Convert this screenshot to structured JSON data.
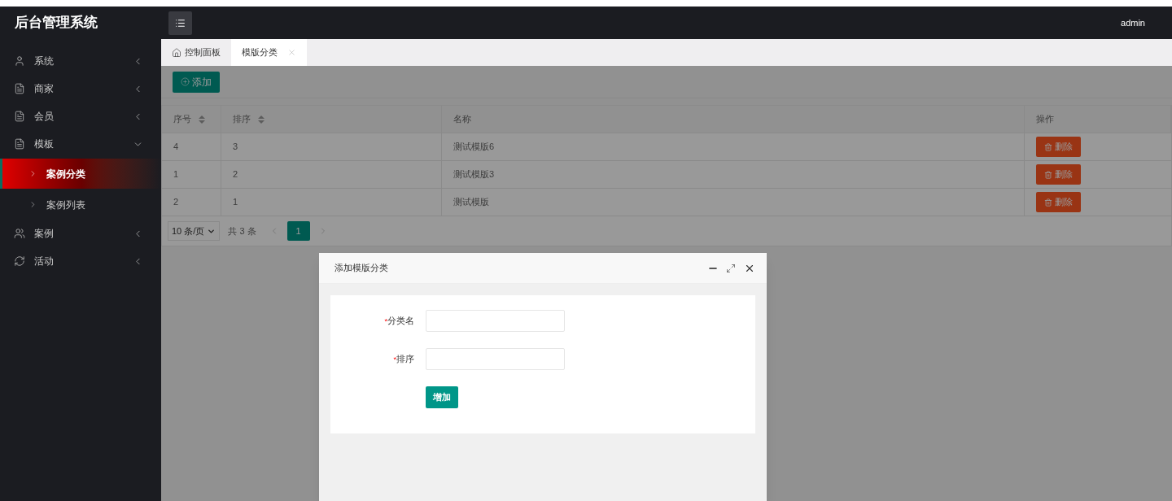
{
  "app_title": "后台管理系统",
  "header": {
    "user": "admin"
  },
  "sidebar": {
    "items": [
      {
        "label": "系统",
        "expanded": false
      },
      {
        "label": "商家",
        "expanded": false
      },
      {
        "label": "会员",
        "expanded": false
      },
      {
        "label": "模板",
        "expanded": true,
        "children": [
          {
            "label": "案例分类",
            "selected": true
          },
          {
            "label": "案例列表",
            "selected": false
          }
        ]
      },
      {
        "label": "案例",
        "expanded": false
      },
      {
        "label": "活动",
        "expanded": false
      }
    ]
  },
  "tabs": [
    {
      "label": "控制面板",
      "kind": "home",
      "selected": false
    },
    {
      "label": "模版分类",
      "kind": "closable",
      "selected": true
    }
  ],
  "toolbar": {
    "add_button": "添加"
  },
  "table": {
    "columns": [
      {
        "label": "序号",
        "sortable": true
      },
      {
        "label": "排序",
        "sortable": true
      },
      {
        "label": "名称",
        "sortable": false
      },
      {
        "label": "操作",
        "sortable": false
      }
    ],
    "rows": [
      {
        "cells": [
          "4",
          "3",
          "测试模版6"
        ],
        "action": "删除"
      },
      {
        "cells": [
          "1",
          "2",
          "测试模版3"
        ],
        "action": "删除"
      },
      {
        "cells": [
          "2",
          "1",
          "测试模版"
        ],
        "action": "删除"
      }
    ]
  },
  "pagination": {
    "page_size": "10 条/页",
    "total": "共 3 条",
    "pages": [
      {
        "label": "1",
        "selected": true
      }
    ]
  },
  "dialog": {
    "title": "添加模版分类",
    "fields": [
      {
        "label": "分类名",
        "required_mark": "*"
      },
      {
        "label": "排序",
        "required_mark": "*"
      }
    ],
    "submit": "增加"
  }
}
